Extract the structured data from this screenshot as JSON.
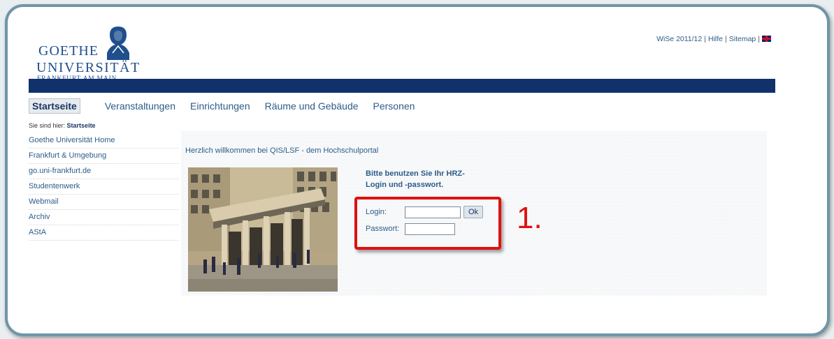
{
  "logo": {
    "line1": "GOETHE",
    "line2": "UNIVERSITÄT",
    "line3": "FRANKFURT AM MAIN"
  },
  "toplinks": {
    "semester": "WiSe 2011/12",
    "help": "Hilfe",
    "sitemap": "Sitemap",
    "separator": "|"
  },
  "nav": {
    "items": [
      "Startseite",
      "Veranstaltungen",
      "Einrichtungen",
      "Räume und Gebäude",
      "Personen"
    ]
  },
  "breadcrumb": {
    "prefix": "Sie sind hier:",
    "current": "Startseite"
  },
  "sidebar": {
    "links": [
      "Goethe Universität Home",
      "Frankfurt & Umgebung",
      "go.uni-frankfurt.de",
      "Studentenwerk",
      "Webmail",
      "Archiv",
      "AStA"
    ]
  },
  "main": {
    "welcome": "Herzlich willkommen bei QIS/LSF - dem Hochschulportal",
    "instruction_line1": "Bitte benutzen Sie Ihr HRZ-",
    "instruction_line2": "Login und -passwort.",
    "login_label": "Login:",
    "password_label": "Passwort:",
    "ok_label": "Ok",
    "login_value": "",
    "password_value": ""
  },
  "annotation": {
    "step": "1."
  },
  "colors": {
    "brand_blue": "#10316b",
    "link_blue": "#2d5c88",
    "highlight_red": "#e01010"
  }
}
